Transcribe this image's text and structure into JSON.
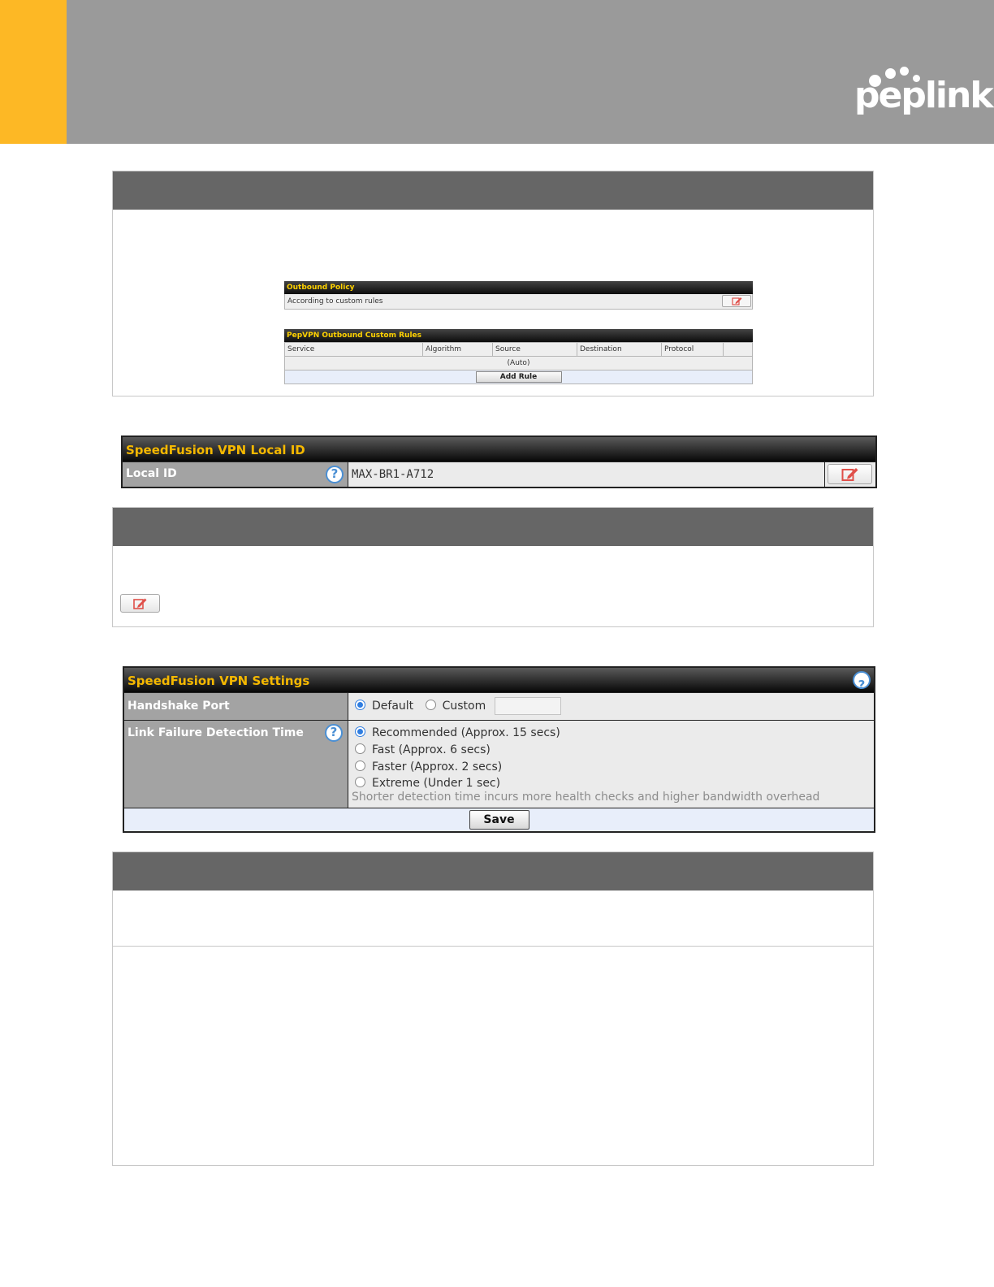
{
  "brand": {
    "logo_text": "peplink",
    "accent_color": "#fdb825",
    "header_color": "#9a9a9a"
  },
  "outbound_policy": {
    "title": "Outbound Policy",
    "value": "According to custom rules"
  },
  "custom_rules": {
    "title": "PepVPN Outbound Custom Rules",
    "columns": [
      "Service",
      "Algorithm",
      "Source",
      "Destination",
      "Protocol"
    ],
    "auto_row": "(Auto)",
    "add_rule_label": "Add Rule"
  },
  "local_id": {
    "title": "SpeedFusion VPN Local ID",
    "label": "Local ID",
    "value": "MAX-BR1-A712"
  },
  "vpn_settings": {
    "title": "SpeedFusion VPN Settings",
    "handshake_port": {
      "label": "Handshake Port",
      "options": [
        "Default",
        "Custom"
      ],
      "selected": "Default",
      "custom_value": ""
    },
    "link_failure": {
      "label": "Link Failure Detection Time",
      "options": [
        "Recommended (Approx. 15 secs)",
        "Fast (Approx. 6 secs)",
        "Faster (Approx. 2 secs)",
        "Extreme (Under 1 sec)"
      ],
      "selected": "Recommended (Approx. 15 secs)",
      "note": "Shorter detection time incurs more health checks and higher bandwidth overhead"
    },
    "save_label": "Save"
  }
}
